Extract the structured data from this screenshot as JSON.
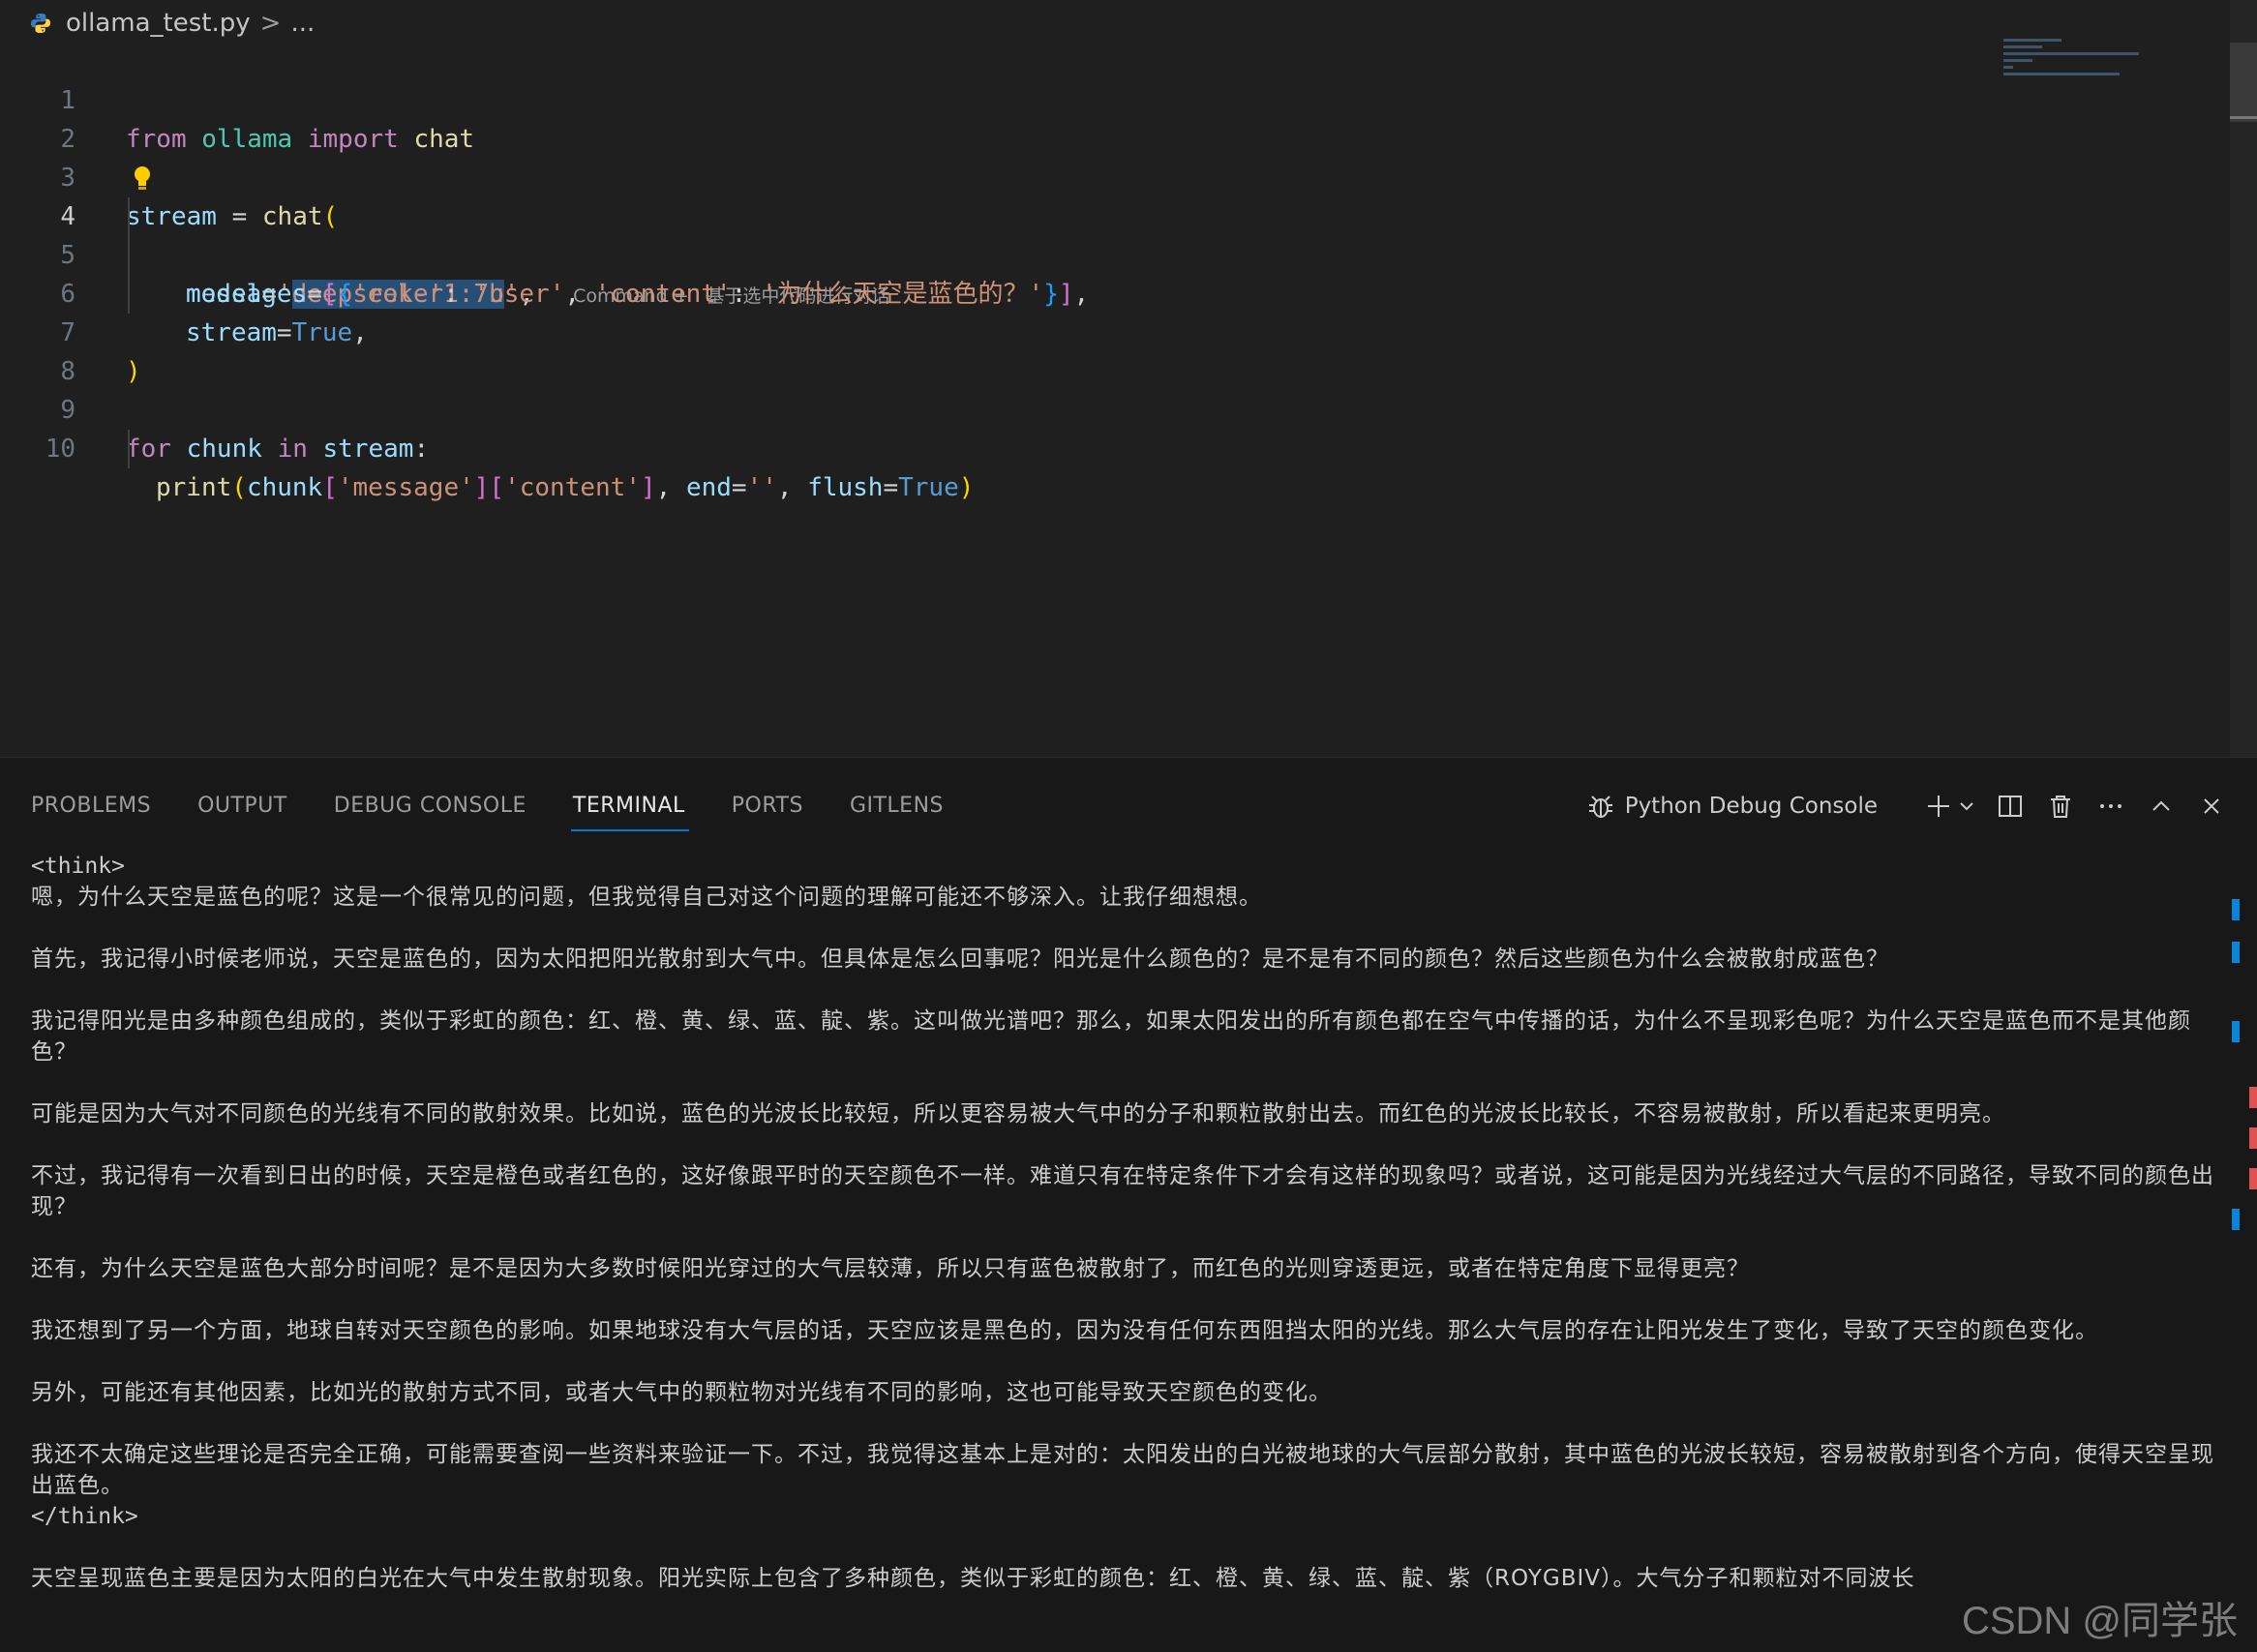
{
  "breadcrumb": {
    "file": "ollama_test.py",
    "separator": ">",
    "ellipsis": "..."
  },
  "editor": {
    "line_numbers": [
      "1",
      "2",
      "3",
      "4",
      "5",
      "6",
      "7",
      "8",
      "9",
      "10"
    ],
    "code": {
      "l1": {
        "from": "from",
        "ollama": "ollama",
        "import": "import",
        "chat": "chat"
      },
      "l3": {
        "stream": "stream",
        "eq": " = ",
        "chat": "chat",
        "paren": "("
      },
      "l4": {
        "key": "model",
        "eq": "=",
        "q1": "'",
        "value": "deepseek-r1:7b",
        "q2": "'",
        "comma": ",",
        "hint": "Command + I 基于选中代码进行对话"
      },
      "l5": {
        "key": "messages",
        "eq": "=",
        "lb": "[",
        "lc": "{",
        "k1": "'role'",
        "c1": ": ",
        "v1": "'user'",
        "s1": ", ",
        "k2": "'content'",
        "c2": ": ",
        "v2": "'为什么天空是蓝色的？'",
        "rc": "}",
        "rb": "]",
        "comma": ","
      },
      "l6": {
        "key": "stream",
        "eq": "=",
        "value": "True",
        "comma": ","
      },
      "l7": {
        "paren": ")"
      },
      "l9": {
        "for": "for",
        "chunk": "chunk",
        "in": "in",
        "stream": "stream",
        "colon": ":"
      },
      "l10": {
        "print": "print",
        "p1": "(",
        "chunk": "chunk",
        "b1": "[",
        "k1": "'message'",
        "b2": "]",
        "b3": "[",
        "k2": "'content'",
        "b4": "]",
        "s1": ", ",
        "end": "end",
        "eq1": "=",
        "ev": "''",
        "s2": ", ",
        "flush": "flush",
        "eq2": "=",
        "fv": "True",
        "p2": ")"
      }
    }
  },
  "panel": {
    "tabs": [
      "PROBLEMS",
      "OUTPUT",
      "DEBUG CONSOLE",
      "TERMINAL",
      "PORTS",
      "GITLENS"
    ],
    "active_tab": "TERMINAL",
    "console_label": "Python Debug Console",
    "terminal": {
      "think_open": "<think>",
      "p1": "嗯，为什么天空是蓝色的呢？这是一个很常见的问题，但我觉得自己对这个问题的理解可能还不够深入。让我仔细想想。",
      "p2": "首先，我记得小时候老师说，天空是蓝色的，因为太阳把阳光散射到大气中。但具体是怎么回事呢？阳光是什么颜色的？是不是有不同的颜色？然后这些颜色为什么会被散射成蓝色？",
      "p3": "我记得阳光是由多种颜色组成的，类似于彩虹的颜色：红、橙、黄、绿、蓝、靛、紫。这叫做光谱吧？那么，如果太阳发出的所有颜色都在空气中传播的话，为什么不呈现彩色呢？为什么天空是蓝色而不是其他颜色？",
      "p4": "可能是因为大气对不同颜色的光线有不同的散射效果。比如说，蓝色的光波长比较短，所以更容易被大气中的分子和颗粒散射出去。而红色的光波长比较长，不容易被散射，所以看起来更明亮。",
      "p5": "不过，我记得有一次看到日出的时候，天空是橙色或者红色的，这好像跟平时的天空颜色不一样。难道只有在特定条件下才会有这样的现象吗？或者说，这可能是因为光线经过大气层的不同路径，导致不同的颜色出现？",
      "p6": "还有，为什么天空是蓝色大部分时间呢？是不是因为大多数时候阳光穿过的大气层较薄，所以只有蓝色被散射了，而红色的光则穿透更远，或者在特定角度下显得更亮？",
      "p7": "我还想到了另一个方面，地球自转对天空颜色的影响。如果地球没有大气层的话，天空应该是黑色的，因为没有任何东西阻挡太阳的光线。那么大气层的存在让阳光发生了变化，导致了天空的颜色变化。",
      "p8": "另外，可能还有其他因素，比如光的散射方式不同，或者大气中的颗粒物对光线有不同的影响，这也可能导致天空颜色的变化。",
      "p9": "我还不太确定这些理论是否完全正确，可能需要查阅一些资料来验证一下。不过，我觉得这基本上是对的：太阳发出的白光被地球的大气层部分散射，其中蓝色的光波长较短，容易被散射到各个方向，使得天空呈现出蓝色。",
      "think_close": "</think>",
      "p10": "天空呈现蓝色主要是因为太阳的白光在大气中发生散射现象。阳光实际上包含了多种颜色，类似于彩虹的颜色：红、橙、黄、绿、蓝、靛、紫（ROYGBIV）。大气分子和颗粒对不同波长"
    }
  },
  "watermark": "CSDN @同学张"
}
